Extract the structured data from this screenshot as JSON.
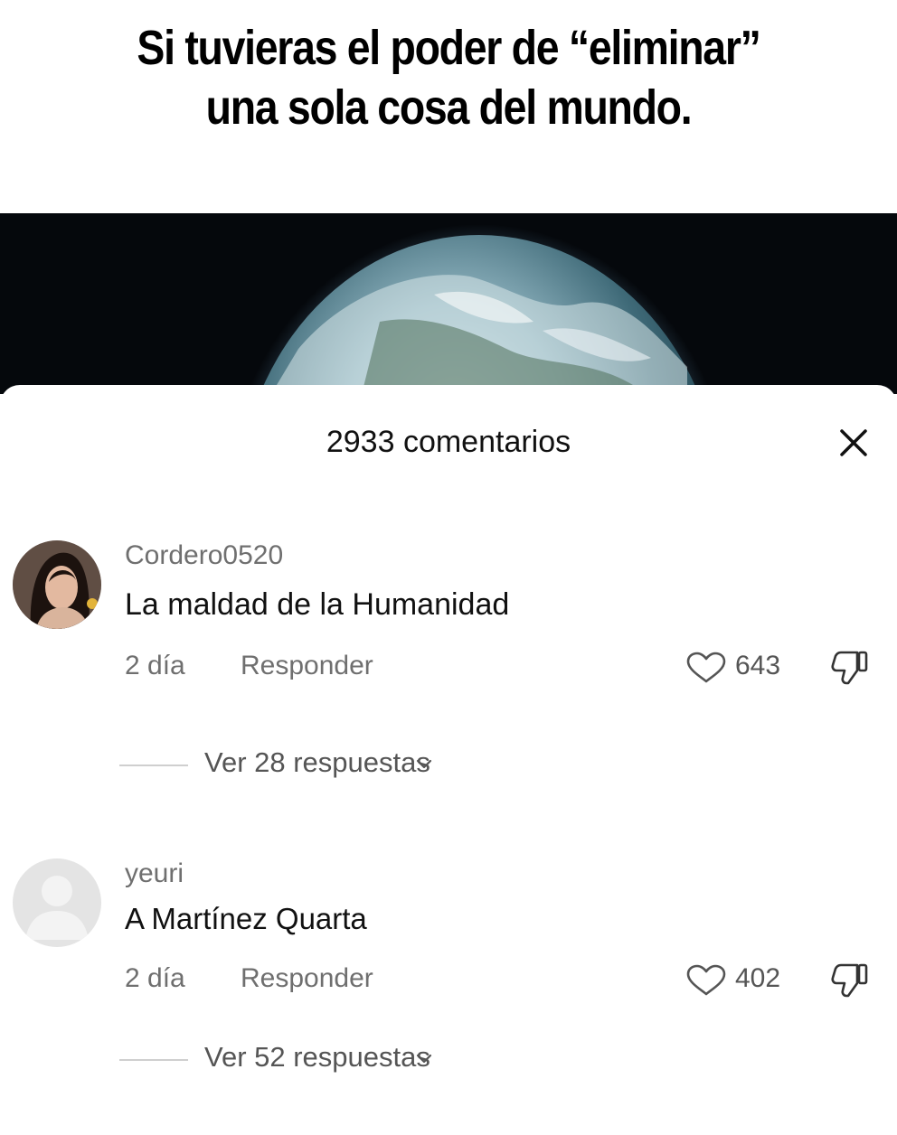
{
  "meme": {
    "title_line1": "Si tuvieras el poder de “eliminar”",
    "title_line2": "una sola cosa del mundo."
  },
  "comments_sheet": {
    "header": "2933 comentarios",
    "close_icon": "close-icon",
    "comments": [
      {
        "username": "Cordero0520",
        "text": "La maldad de la Humanidad",
        "time": "2 día",
        "reply_label": "Responder",
        "likes": "643",
        "view_replies": "Ver 28 respuestas"
      },
      {
        "username": "yeuri",
        "text": "A Martínez Quarta",
        "time": "2 día",
        "reply_label": "Responder",
        "likes": "402",
        "view_replies": "Ver 52 respuestas"
      }
    ]
  },
  "colors": {
    "text_primary": "#111111",
    "text_secondary": "#6f6f6f",
    "video_background": "#05080c"
  }
}
